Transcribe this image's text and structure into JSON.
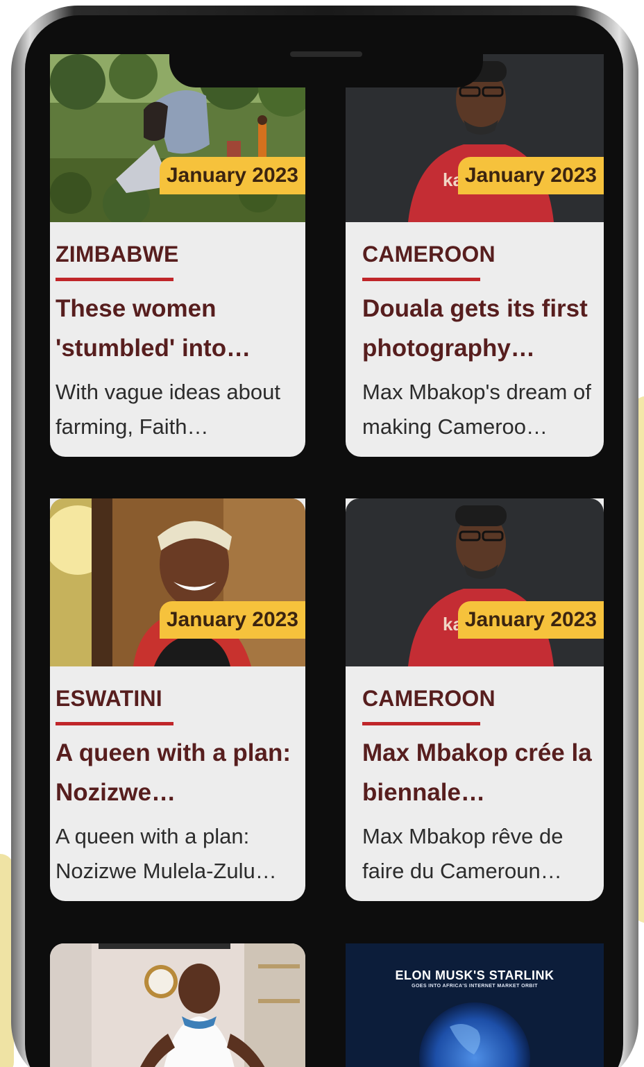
{
  "cards": [
    {
      "date": "January 2023",
      "country": "ZIMBABWE",
      "headline": "These women 'stumbled' into…",
      "summary": "With vague ideas about farming, Faith…",
      "image": "farm-workers-photo"
    },
    {
      "date": "January 2023",
      "country": "CAMEROON",
      "headline": "Douala gets its first photography…",
      "summary": "Max Mbakop's dream of making Cameroo…",
      "image": "man-red-shirt-photo"
    },
    {
      "date": "January 2023",
      "country": "ESWATINI",
      "headline": "A queen with a plan: Nozizwe…",
      "summary": "A queen with a plan: Nozizwe Mulela-Zulu…",
      "image": "smiling-woman-photo"
    },
    {
      "date": "January 2023",
      "country": "CAMEROON",
      "headline": "Max Mbakop crée la biennale…",
      "summary": "Max Mbakop rêve de faire du Cameroun…",
      "image": "man-red-shirt-photo"
    },
    {
      "image": "woman-white-dress-photo"
    },
    {
      "image": "starlink-globe-graphic",
      "image_title": "ELON MUSK'S STARLINK",
      "image_subtitle": "GOES INTO AFRICA'S INTERNET MARKET ORBIT"
    }
  ],
  "colors": {
    "badge": "#f6c23c",
    "heading": "#571e1e",
    "rule": "#c0262a",
    "card_bg": "#ededed"
  }
}
